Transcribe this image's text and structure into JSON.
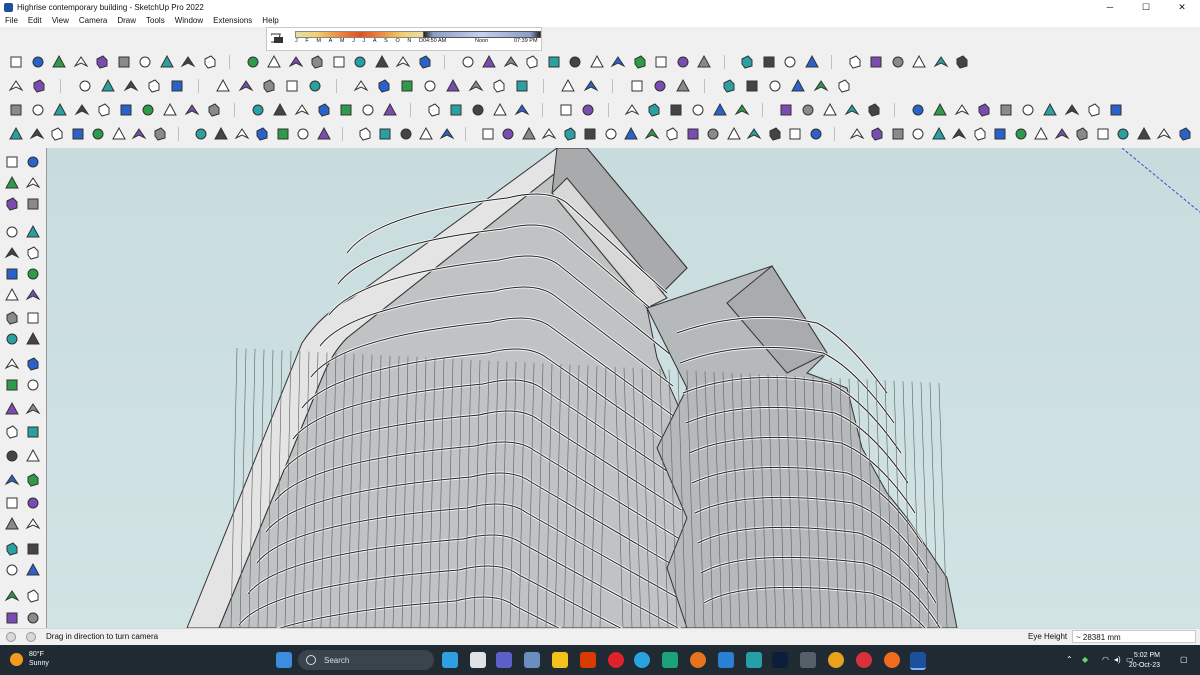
{
  "window": {
    "title": "Highrise contemporary building - SketchUp Pro 2022",
    "controls": {
      "minimize": "─",
      "maximize": "☐",
      "close": "✕"
    }
  },
  "menu": [
    "File",
    "Edit",
    "View",
    "Camera",
    "Draw",
    "Tools",
    "Window",
    "Extensions",
    "Help"
  ],
  "shadows": {
    "months": [
      "J",
      "F",
      "M",
      "A",
      "M",
      "J",
      "J",
      "A",
      "S",
      "O",
      "N",
      "D"
    ],
    "time_start": "04:50 AM",
    "time_mid": "Noon",
    "time_end": "07:39 PM"
  },
  "status": {
    "hint": "Drag in direction to turn camera",
    "measure_label": "Eye Height",
    "measure_value": "~ 28381 mm"
  },
  "taskbar": {
    "weather_temp": "80°F",
    "weather_desc": "Sunny",
    "search_placeholder": "Search",
    "time": "5:02 PM",
    "date": "20-Oct-23"
  },
  "colors": {
    "sky": "#cde0e1",
    "taskbar": "#1f2a33",
    "brand": "#1c4f9c"
  }
}
